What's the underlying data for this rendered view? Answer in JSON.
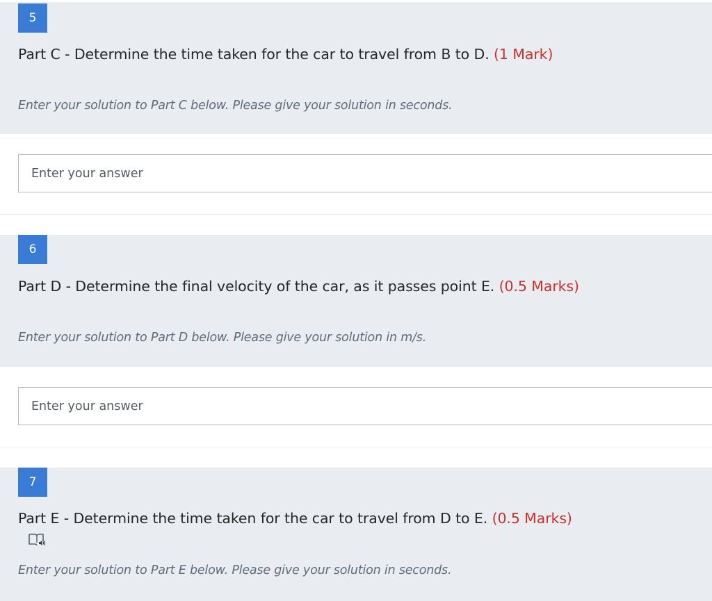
{
  "questions": [
    {
      "number": "5",
      "title": "Part C - Determine the time taken for the car to travel from B to D.",
      "marks": "(1 Mark)",
      "instruction": "Enter your solution to Part C below. Please give your solution in seconds.",
      "answer_placeholder": "Enter your answer"
    },
    {
      "number": "6",
      "title": "Part D - Determine the final velocity of the car, as it passes point E.",
      "marks": "(0.5 Marks)",
      "instruction": "Enter your solution to Part D below. Please give your solution in m/s.",
      "answer_placeholder": "Enter your answer"
    },
    {
      "number": "7",
      "title": "Part E - Determine the time taken for the car to travel from D to E.",
      "marks": "(0.5 Marks)",
      "icon": "immersive-reader-icon",
      "instruction": "Enter your solution to Part E below. Please give your solution in seconds."
    }
  ],
  "colors": {
    "question_bg": "#e9edf2",
    "number_badge": "#3a7bd5",
    "marks_text": "#c8322a",
    "instruction_text": "#5f6b78"
  }
}
